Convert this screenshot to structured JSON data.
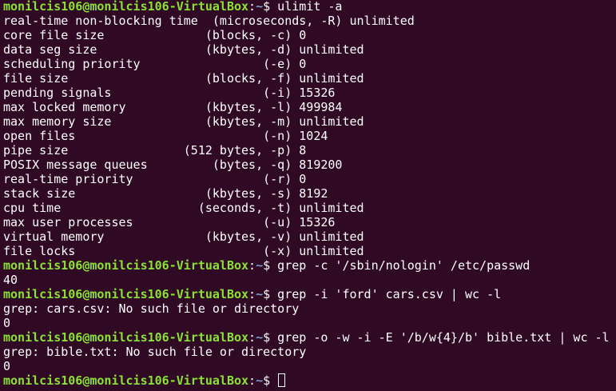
{
  "theme": {
    "background": "#300a24",
    "text": "#ffffff",
    "user_host": "#8ae234",
    "path": "#729fcf"
  },
  "prompt": {
    "user_host": "monilcis106@monilcis106-VirtualBox",
    "colon": ":",
    "path": "~",
    "dollar": "$ "
  },
  "lines": [
    {
      "type": "prompt",
      "command": "ulimit -a"
    },
    {
      "type": "output",
      "text": "real-time non-blocking time  (microseconds, -R) unlimited"
    },
    {
      "type": "output",
      "text": "core file size              (blocks, -c) 0"
    },
    {
      "type": "output",
      "text": "data seg size               (kbytes, -d) unlimited"
    },
    {
      "type": "output",
      "text": "scheduling priority                 (-e) 0"
    },
    {
      "type": "output",
      "text": "file size                   (blocks, -f) unlimited"
    },
    {
      "type": "output",
      "text": "pending signals                     (-i) 15326"
    },
    {
      "type": "output",
      "text": "max locked memory           (kbytes, -l) 499984"
    },
    {
      "type": "output",
      "text": "max memory size             (kbytes, -m) unlimited"
    },
    {
      "type": "output",
      "text": "open files                          (-n) 1024"
    },
    {
      "type": "output",
      "text": "pipe size                (512 bytes, -p) 8"
    },
    {
      "type": "output",
      "text": "POSIX message queues         (bytes, -q) 819200"
    },
    {
      "type": "output",
      "text": "real-time priority                  (-r) 0"
    },
    {
      "type": "output",
      "text": "stack size                  (kbytes, -s) 8192"
    },
    {
      "type": "output",
      "text": "cpu time                   (seconds, -t) unlimited"
    },
    {
      "type": "output",
      "text": "max user processes                  (-u) 15326"
    },
    {
      "type": "output",
      "text": "virtual memory              (kbytes, -v) unlimited"
    },
    {
      "type": "output",
      "text": "file locks                          (-x) unlimited"
    },
    {
      "type": "prompt",
      "command": "grep -c '/sbin/nologin' /etc/passwd"
    },
    {
      "type": "output",
      "text": "40"
    },
    {
      "type": "prompt",
      "command": "grep -i 'ford' cars.csv | wc -l"
    },
    {
      "type": "output",
      "text": "grep: cars.csv: No such file or directory"
    },
    {
      "type": "output",
      "text": "0"
    },
    {
      "type": "prompt",
      "command": "grep -o -w -i -E '/b/w{4}/b' bible.txt | wc -l"
    },
    {
      "type": "output",
      "text": "grep: bible.txt: No such file or directory"
    },
    {
      "type": "output",
      "text": "0"
    },
    {
      "type": "prompt",
      "command": "",
      "cursor": true
    }
  ]
}
